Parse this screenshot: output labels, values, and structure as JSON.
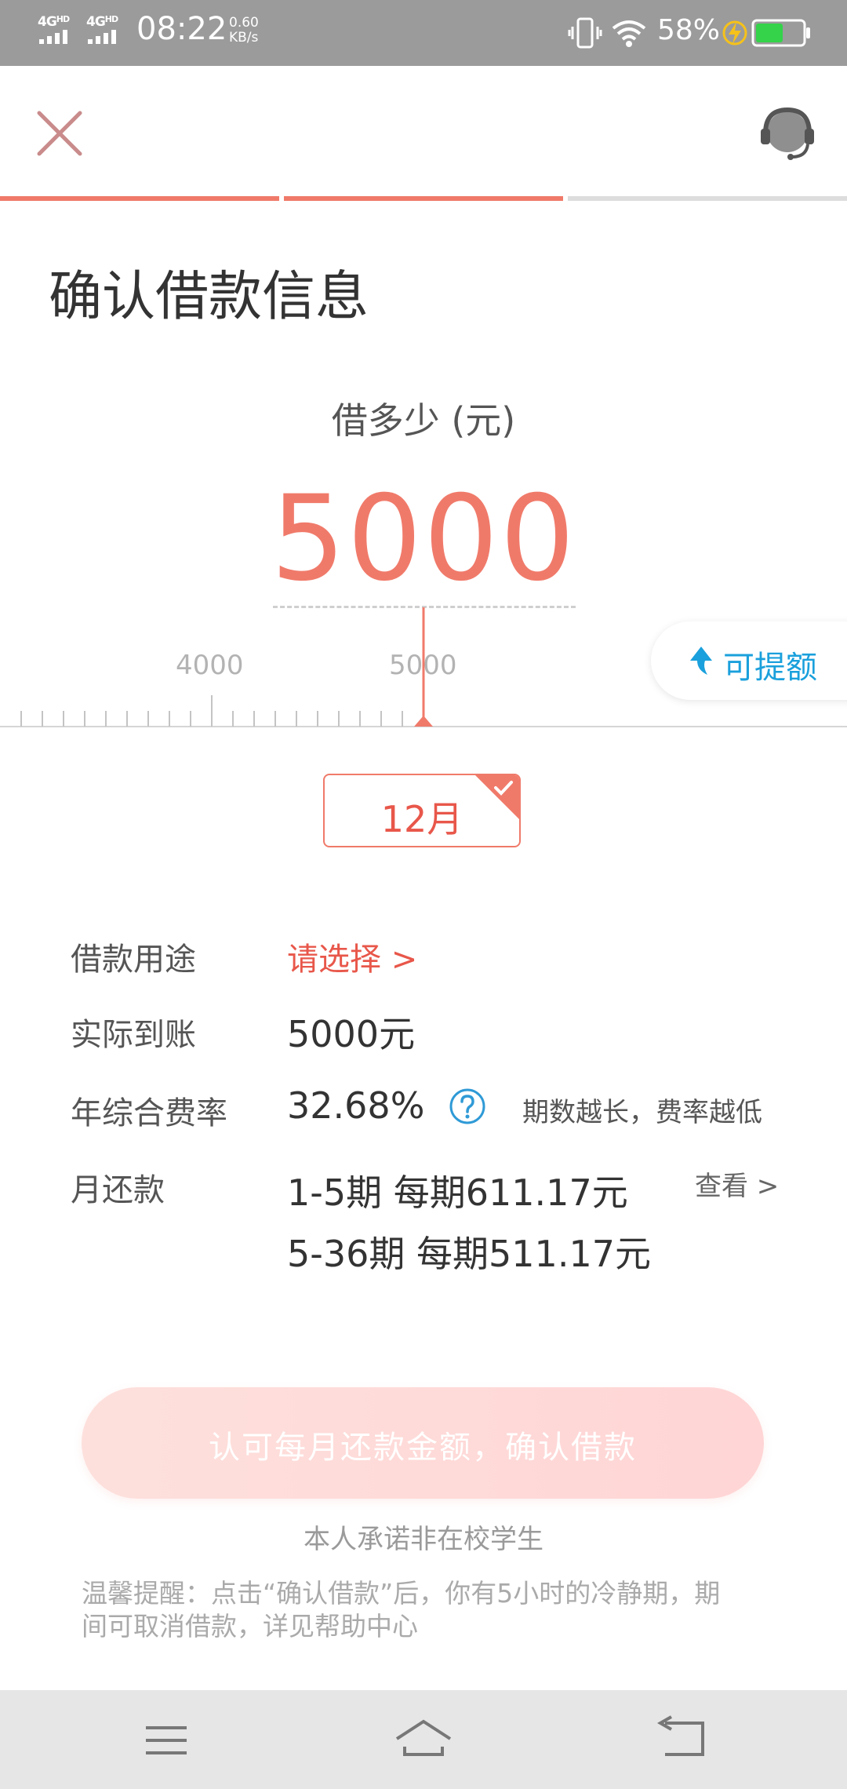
{
  "status_bar": {
    "network_1": "4G",
    "network_2": "4G",
    "hd": "HD",
    "time": "08:22",
    "speed_value": "0.60",
    "speed_unit": "KB/s",
    "battery_percent": "58%",
    "battery_level": 0.58,
    "icons": [
      "signal-icon",
      "vibrate-icon",
      "wifi-icon",
      "charging-icon",
      "battery-icon"
    ]
  },
  "header": {
    "close_icon": "close-icon",
    "support_icon": "headset-icon",
    "progress_steps_total": 3,
    "progress_steps_done": 2
  },
  "page": {
    "title": "确认借款信息"
  },
  "amount": {
    "label": "借多少 (元)",
    "value": "5000",
    "ruler_labels": [
      "4000",
      "5000"
    ],
    "raise_limit_label": "可提额"
  },
  "term": {
    "selected": "12月"
  },
  "info": {
    "purpose_label": "借款用途",
    "purpose_value": "请选择 >",
    "received_label": "实际到账",
    "received_value": "5000元",
    "rate_label": "年综合费率",
    "rate_value": "32.68%",
    "rate_help_icon": "question-circle-icon",
    "rate_note": "期数越长，费率越低",
    "monthly_label": "月还款",
    "monthly_line1": "1-5期 每期611.17元",
    "monthly_line2": "5-36期 每期511.17元",
    "view_link": "查看 >"
  },
  "actions": {
    "confirm_label": "认可每月还款金额，确认借款",
    "pledge": "本人承诺非在校学生",
    "reminder": "温馨提醒：点击“确认借款”后，你有5小时的冷静期，期间可取消借款，详见帮助中心"
  },
  "colors": {
    "accent": "#f07a6a",
    "accent_text": "#e8574a",
    "link_blue": "#1aa0dc",
    "status_bar_bg": "#9b9b9b",
    "nav_bar_bg": "#e6e6e6",
    "battery_green": "#34d34a"
  },
  "nav_bar": {
    "icons": [
      "menu-icon",
      "home-icon",
      "back-icon"
    ]
  }
}
